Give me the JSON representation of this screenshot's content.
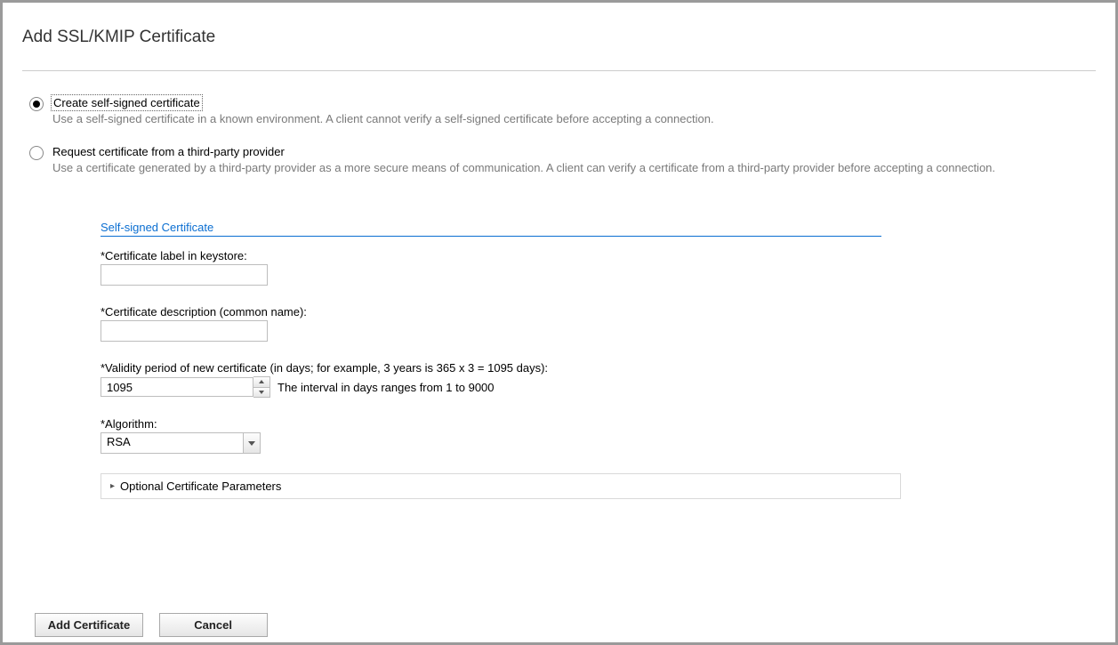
{
  "title": "Add SSL/KMIP Certificate",
  "options": {
    "self": {
      "label": "Create self-signed certificate",
      "desc": "Use a self-signed certificate in a known environment. A client cannot verify a self-signed certificate before accepting a connection.",
      "selected": true
    },
    "third": {
      "label": "Request certificate from a third-party provider",
      "desc": "Use a certificate generated by a third-party provider as a more secure means of communication. A client can verify a certificate from a third-party provider before accepting a connection.",
      "selected": false
    }
  },
  "section": {
    "title": "Self-signed Certificate"
  },
  "fields": {
    "label": {
      "label": "*Certificate label in keystore:",
      "value": ""
    },
    "desc": {
      "label": "*Certificate description (common name):",
      "value": ""
    },
    "validity": {
      "label": "*Validity period of new certificate (in days; for example, 3 years is 365 x 3 = 1095 days):",
      "value": "1095",
      "hint": "The interval in days ranges from 1 to 9000"
    },
    "algorithm": {
      "label": "*Algorithm:",
      "value": "RSA"
    },
    "optional": {
      "label": "Optional Certificate Parameters"
    }
  },
  "buttons": {
    "add": "Add Certificate",
    "cancel": "Cancel"
  }
}
